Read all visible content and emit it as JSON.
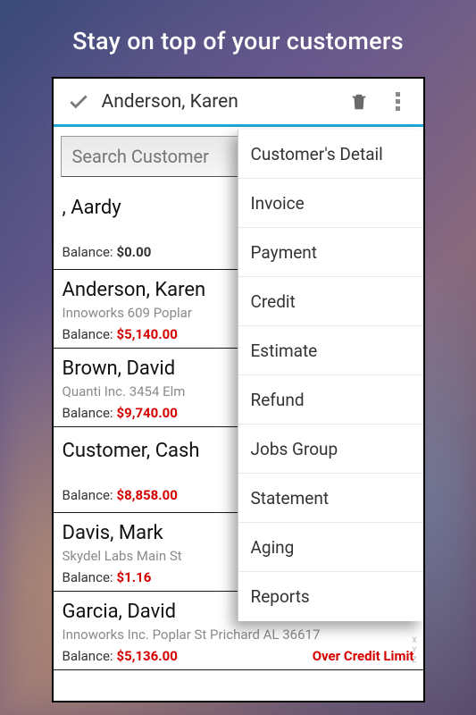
{
  "headline": "Stay on top of your customers",
  "toolbar": {
    "title": "Anderson, Karen"
  },
  "search": {
    "placeholder": "Search Customer",
    "value": ""
  },
  "colors": {
    "accent": "#1ea6d6",
    "warn": "#d40000"
  },
  "customers": [
    {
      "name": ", Aardy",
      "address": "",
      "balance_label": "Balance:",
      "balance": "$0.00",
      "over_limit": false,
      "balance_red": false
    },
    {
      "name": "Anderson, Karen",
      "address": "Innoworks 609 Poplar",
      "balance_label": "Balance:",
      "balance": "$5,140.00",
      "over_limit": false,
      "balance_red": true
    },
    {
      "name": "Brown, David",
      "address": "Quanti Inc. 3454 Elm",
      "balance_label": "Balance:",
      "balance": "$9,740.00",
      "over_limit": false,
      "balance_red": true
    },
    {
      "name": "Customer, Cash",
      "address": "",
      "balance_label": "Balance:",
      "balance": "$8,858.00",
      "over_limit": false,
      "balance_red": true
    },
    {
      "name": "Davis, Mark",
      "address": "Skydel Labs Main St",
      "balance_label": "Balance:",
      "balance": "$1.16",
      "over_limit": false,
      "balance_red": true
    },
    {
      "name": "Garcia, David",
      "address": "Innoworks Inc. Poplar St Prichard  AL 36617",
      "balance_label": "Balance:",
      "balance": "$5,136.00",
      "over_limit": true,
      "balance_red": true
    }
  ],
  "over_limit_label": "Over Credit Limit",
  "menu": {
    "items": [
      {
        "label": "Customer's Detail"
      },
      {
        "label": "Invoice"
      },
      {
        "label": "Payment"
      },
      {
        "label": "Credit"
      },
      {
        "label": "Estimate"
      },
      {
        "label": "Refund"
      },
      {
        "label": "Jobs Group"
      },
      {
        "label": "Statement"
      },
      {
        "label": "Aging"
      },
      {
        "label": "Reports"
      }
    ]
  },
  "alpha_index": [
    "X",
    "Y",
    "Z"
  ]
}
